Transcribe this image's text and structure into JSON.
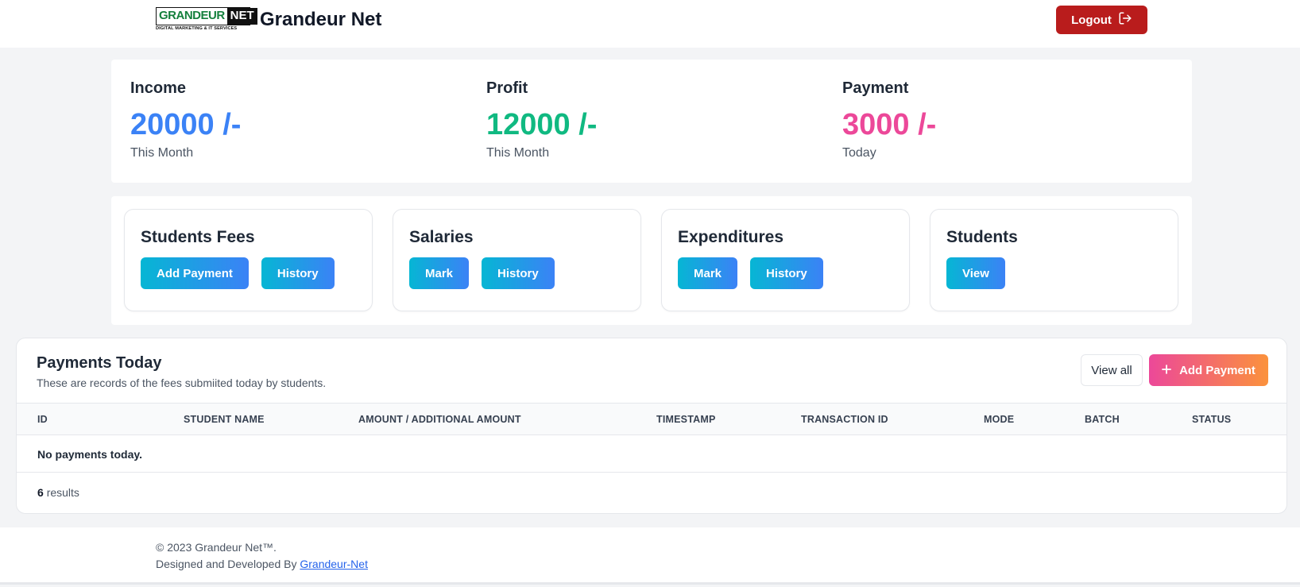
{
  "header": {
    "logo_word": "GRANDEUR",
    "logo_net": "NET",
    "logo_tagline": "DIGITAL MARKETING & IT SERVICES",
    "brand_name": "Grandeur Net",
    "logout_label": "Logout",
    "logout_icon": "logout-arrow-icon",
    "logout_color": "#b91c1c"
  },
  "stats": [
    {
      "label": "Income",
      "value": "20000 /-",
      "period": "This Month",
      "color": "#3b82f6"
    },
    {
      "label": "Profit",
      "value": "12000 /-",
      "period": "This Month",
      "color": "#10b981"
    },
    {
      "label": "Payment",
      "value": "3000 /-",
      "period": "Today",
      "color": "#ec4899"
    }
  ],
  "modules": [
    {
      "title": "Students Fees",
      "buttons": [
        "Add Payment",
        "History"
      ]
    },
    {
      "title": "Salaries",
      "buttons": [
        "Mark",
        "History"
      ]
    },
    {
      "title": "Expenditures",
      "buttons": [
        "Mark",
        "History"
      ]
    },
    {
      "title": "Students",
      "buttons": [
        "View"
      ]
    }
  ],
  "payments": {
    "title": "Payments Today",
    "subtitle": "These are records of the fees submiited today by students.",
    "view_all": "View all",
    "add_payment": "Add Payment",
    "add_icon": "plus-icon",
    "columns": [
      "ID",
      "STUDENT NAME",
      "AMOUNT / ADDITIONAL AMOUNT",
      "TIMESTAMP",
      "TRANSACTION ID",
      "MODE",
      "BATCH",
      "STATUS"
    ],
    "empty_message": "No payments today.",
    "results_count": "6",
    "results_label": "results"
  },
  "footer": {
    "copyright": "© 2023 Grandeur Net™.",
    "designed_by": "Designed and Developed By",
    "link_text": "Grandeur-Net"
  }
}
